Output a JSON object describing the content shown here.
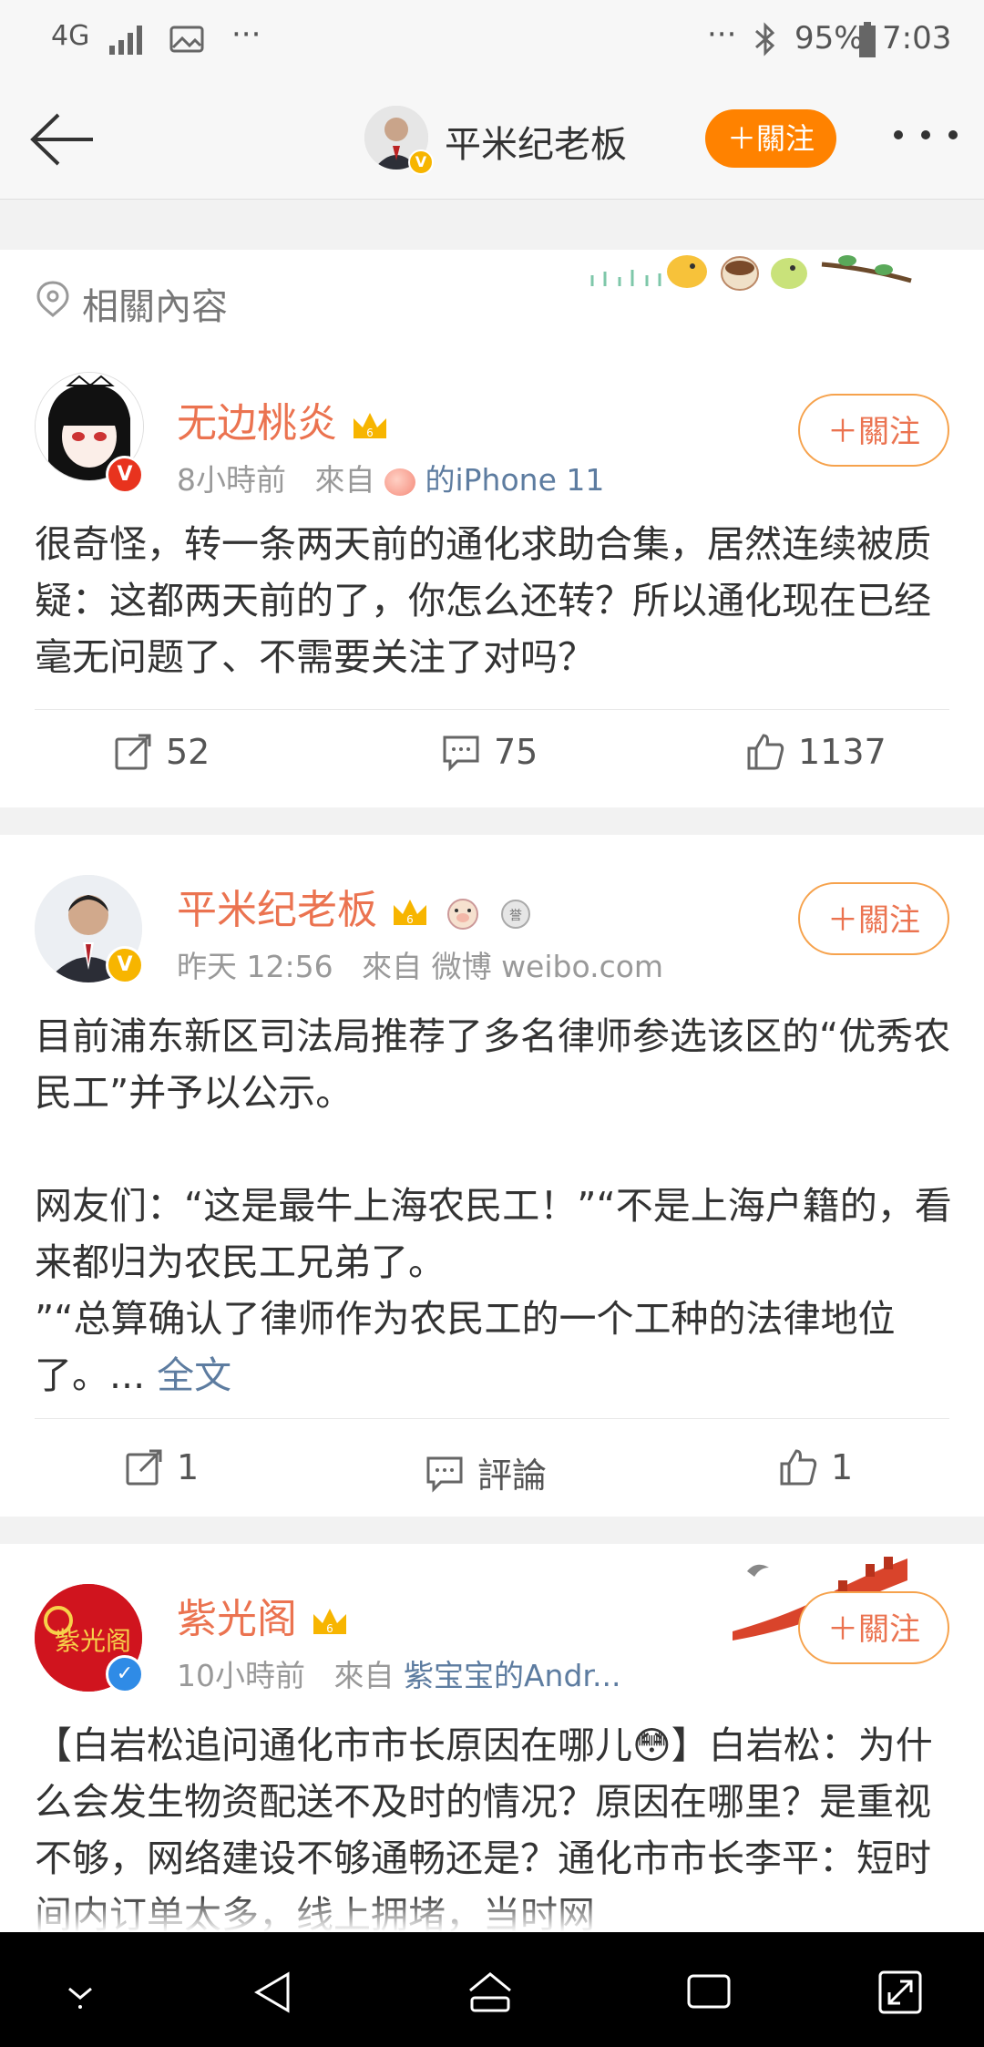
{
  "status_bar": {
    "network": "4G",
    "battery": "95%",
    "time": "7:03"
  },
  "header": {
    "title": "平米纪老板",
    "follow_label": "＋關注"
  },
  "related": {
    "label": "相關內容"
  },
  "posts": [
    {
      "username": "无边桃炎",
      "time": "8小時前",
      "from_label": "來自",
      "source": "的iPhone 11",
      "follow_label": "＋關注",
      "text": "很奇怪，转一条两天前的通化求助合集，居然连续被质疑：这都两天前的了，你怎么还转？所以通化现在已经毫无问题了、不需要关注了对吗？",
      "reposts": "52",
      "comments": "75",
      "likes": "1137"
    },
    {
      "username": "平米纪老板",
      "time": "昨天 12:56",
      "from_label": "來自",
      "source": "微博 weibo.com",
      "follow_label": "＋關注",
      "text": "目前浦东新区司法局推荐了多名律师参选该区的“优秀农民工”并予以公示。\n\n网友们：“这是最牛上海农民工！”“不是上海户籍的，看来都归为农民工兄弟了。\n”“总算确认了律师作为农民工的一个工种的法律地位了。... ",
      "more_label": "全文",
      "reposts": "1",
      "comments": "評論",
      "likes": "1"
    },
    {
      "username": "紫光阁",
      "time": "10小時前",
      "from_label": "來自",
      "source": "紫宝宝的Andr...",
      "follow_label": "＋關注",
      "avatar_text": "紫光阁",
      "text": "【白岩松追问通化市市长原因在哪儿😳】白岩松：为什么会发生物资配送不及时的情况？原因在哪里？是重视不够，网络建设不够通畅还是？通化市市长李平：短时间内订单太多，线上拥堵，当时网"
    }
  ],
  "colors": {
    "accent": "#ff8200",
    "username": "#eb7350",
    "link": "#5d7ca0"
  }
}
